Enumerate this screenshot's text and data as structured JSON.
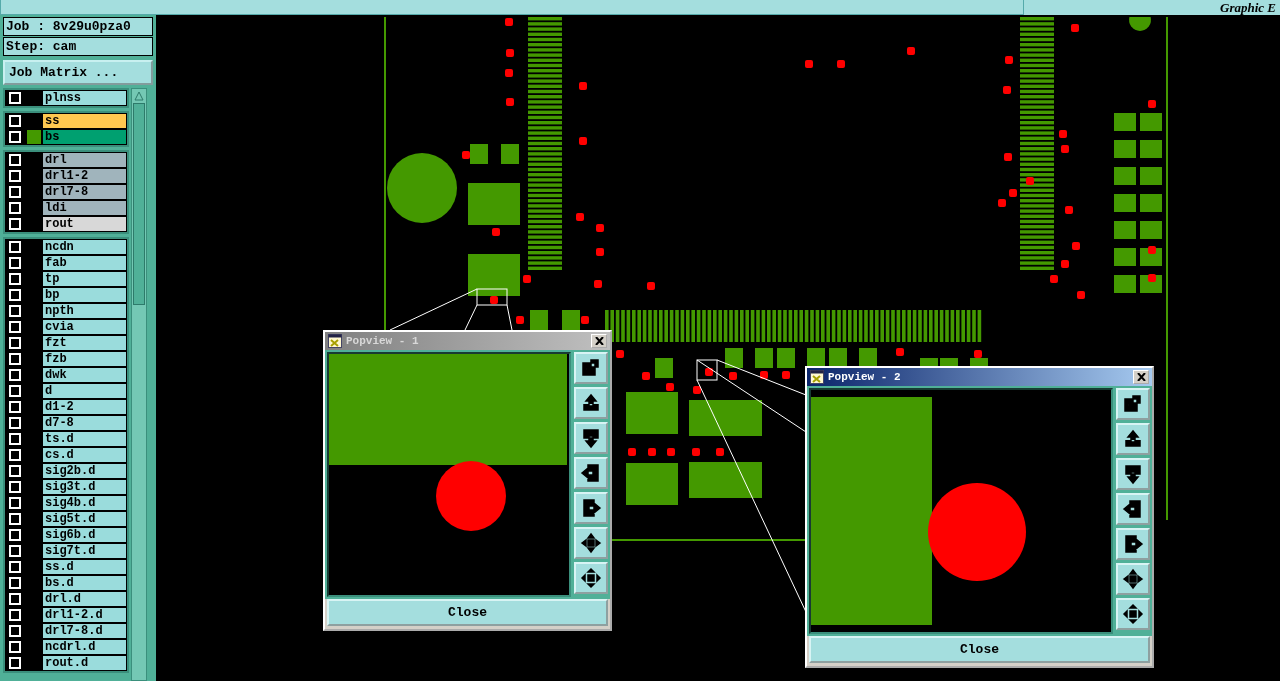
{
  "top_bar": {
    "title": "Graphic E"
  },
  "job": {
    "job_label": "Job : 8v29u0pza0",
    "step_label": "Step: cam",
    "matrix_button": "Job Matrix ..."
  },
  "layer_groups": [
    [
      {
        "name": "plnss",
        "color": "#9adcdc",
        "checked": false,
        "displayed": false
      }
    ],
    [
      {
        "name": "ss",
        "color": "#ffc850",
        "checked": false,
        "displayed": false
      },
      {
        "name": "bs",
        "color": "#00a070",
        "checked": false,
        "displayed": true
      }
    ],
    [
      {
        "name": "drl",
        "color": "#a0b4bc",
        "checked": false,
        "displayed": false
      },
      {
        "name": "drl1-2",
        "color": "#a0b4bc",
        "checked": false,
        "displayed": false
      },
      {
        "name": "drl7-8",
        "color": "#a0b4bc",
        "checked": false,
        "displayed": false
      },
      {
        "name": "ldi",
        "color": "#a0b4bc",
        "checked": false,
        "displayed": false
      },
      {
        "name": "rout",
        "color": "#d8d8d8",
        "checked": false,
        "displayed": false
      }
    ],
    [
      {
        "name": "ncdn",
        "color": "#9adcdc",
        "checked": false,
        "displayed": false
      },
      {
        "name": "fab",
        "color": "#9adcdc",
        "checked": false,
        "displayed": false
      },
      {
        "name": "tp",
        "color": "#9adcdc",
        "checked": false,
        "displayed": false
      },
      {
        "name": "bp",
        "color": "#9adcdc",
        "checked": false,
        "displayed": false
      },
      {
        "name": "npth",
        "color": "#9adcdc",
        "checked": false,
        "displayed": false
      },
      {
        "name": "cvia",
        "color": "#9adcdc",
        "checked": false,
        "displayed": false
      },
      {
        "name": "fzt",
        "color": "#9adcdc",
        "checked": false,
        "displayed": false
      },
      {
        "name": "fzb",
        "color": "#9adcdc",
        "checked": false,
        "displayed": false
      },
      {
        "name": "dwk",
        "color": "#9adcdc",
        "checked": false,
        "displayed": false
      },
      {
        "name": "d",
        "color": "#9adcdc",
        "checked": false,
        "displayed": false
      },
      {
        "name": "d1-2",
        "color": "#9adcdc",
        "checked": false,
        "displayed": false
      },
      {
        "name": "d7-8",
        "color": "#9adcdc",
        "checked": false,
        "displayed": false
      },
      {
        "name": "ts.d",
        "color": "#9adcdc",
        "checked": false,
        "displayed": false
      },
      {
        "name": "cs.d",
        "color": "#9adcdc",
        "checked": false,
        "displayed": false
      },
      {
        "name": "sig2b.d",
        "color": "#9adcdc",
        "checked": false,
        "displayed": false
      },
      {
        "name": "sig3t.d",
        "color": "#9adcdc",
        "checked": false,
        "displayed": false
      },
      {
        "name": "sig4b.d",
        "color": "#9adcdc",
        "checked": false,
        "displayed": false
      },
      {
        "name": "sig5t.d",
        "color": "#9adcdc",
        "checked": false,
        "displayed": false
      },
      {
        "name": "sig6b.d",
        "color": "#9adcdc",
        "checked": false,
        "displayed": false
      },
      {
        "name": "sig7t.d",
        "color": "#9adcdc",
        "checked": false,
        "displayed": false
      },
      {
        "name": "ss.d",
        "color": "#9adcdc",
        "checked": false,
        "displayed": false
      },
      {
        "name": "bs.d",
        "color": "#9adcdc",
        "checked": false,
        "displayed": false
      },
      {
        "name": "drl.d",
        "color": "#9adcdc",
        "checked": false,
        "displayed": false
      },
      {
        "name": "drl1-2.d",
        "color": "#9adcdc",
        "checked": false,
        "displayed": false
      },
      {
        "name": "drl7-8.d",
        "color": "#9adcdc",
        "checked": false,
        "displayed": false
      },
      {
        "name": "ncdrl.d",
        "color": "#9adcdc",
        "checked": false,
        "displayed": false
      },
      {
        "name": "rout.d",
        "color": "#9adcdc",
        "checked": false,
        "displayed": false
      }
    ]
  ],
  "popviews": [
    {
      "title": "Popview - 1",
      "active": false,
      "close_label": "Close"
    },
    {
      "title": "Popview - 2",
      "active": true,
      "close_label": "Close"
    }
  ]
}
